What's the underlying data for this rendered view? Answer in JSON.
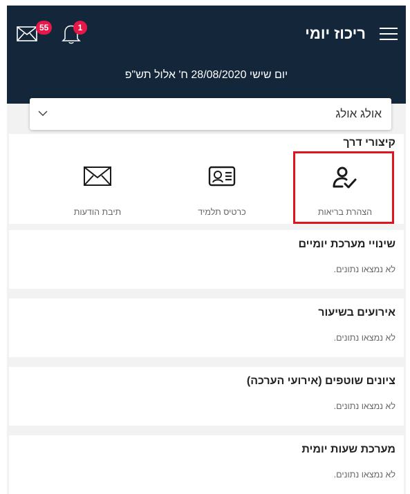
{
  "header": {
    "title": "ריכוז יומי",
    "mail_badge": "55",
    "notifications_badge": "1",
    "date_line": "יום שישי 28/08/2020 ח' אלול תש\"פ",
    "background_color": "#14263a",
    "badge_color": "#e8174a"
  },
  "student_select": {
    "selected": "אולג אולג"
  },
  "shortcuts": {
    "title": "קיצורי דרך",
    "items": [
      {
        "label": "הצהרת בריאות",
        "icon": "health-declaration-icon"
      },
      {
        "label": "כרטיס תלמיד",
        "icon": "student-card-icon"
      },
      {
        "label": "תיבת הודעות",
        "icon": "envelope-icon"
      }
    ],
    "highlight_color": "#e0141c"
  },
  "sections": [
    {
      "title": "שינויי מערכת יומיים",
      "empty_text": "לא נמצאו נתונים."
    },
    {
      "title": "אירועים בשיעור",
      "empty_text": "לא נמצאו נתונים."
    },
    {
      "title": "ציונים שוטפים (אירועי הערכה)",
      "empty_text": "לא נמצאו נתונים."
    },
    {
      "title": "מערכת שעות יומית",
      "empty_text": "לא נמצאו נתונים."
    }
  ]
}
